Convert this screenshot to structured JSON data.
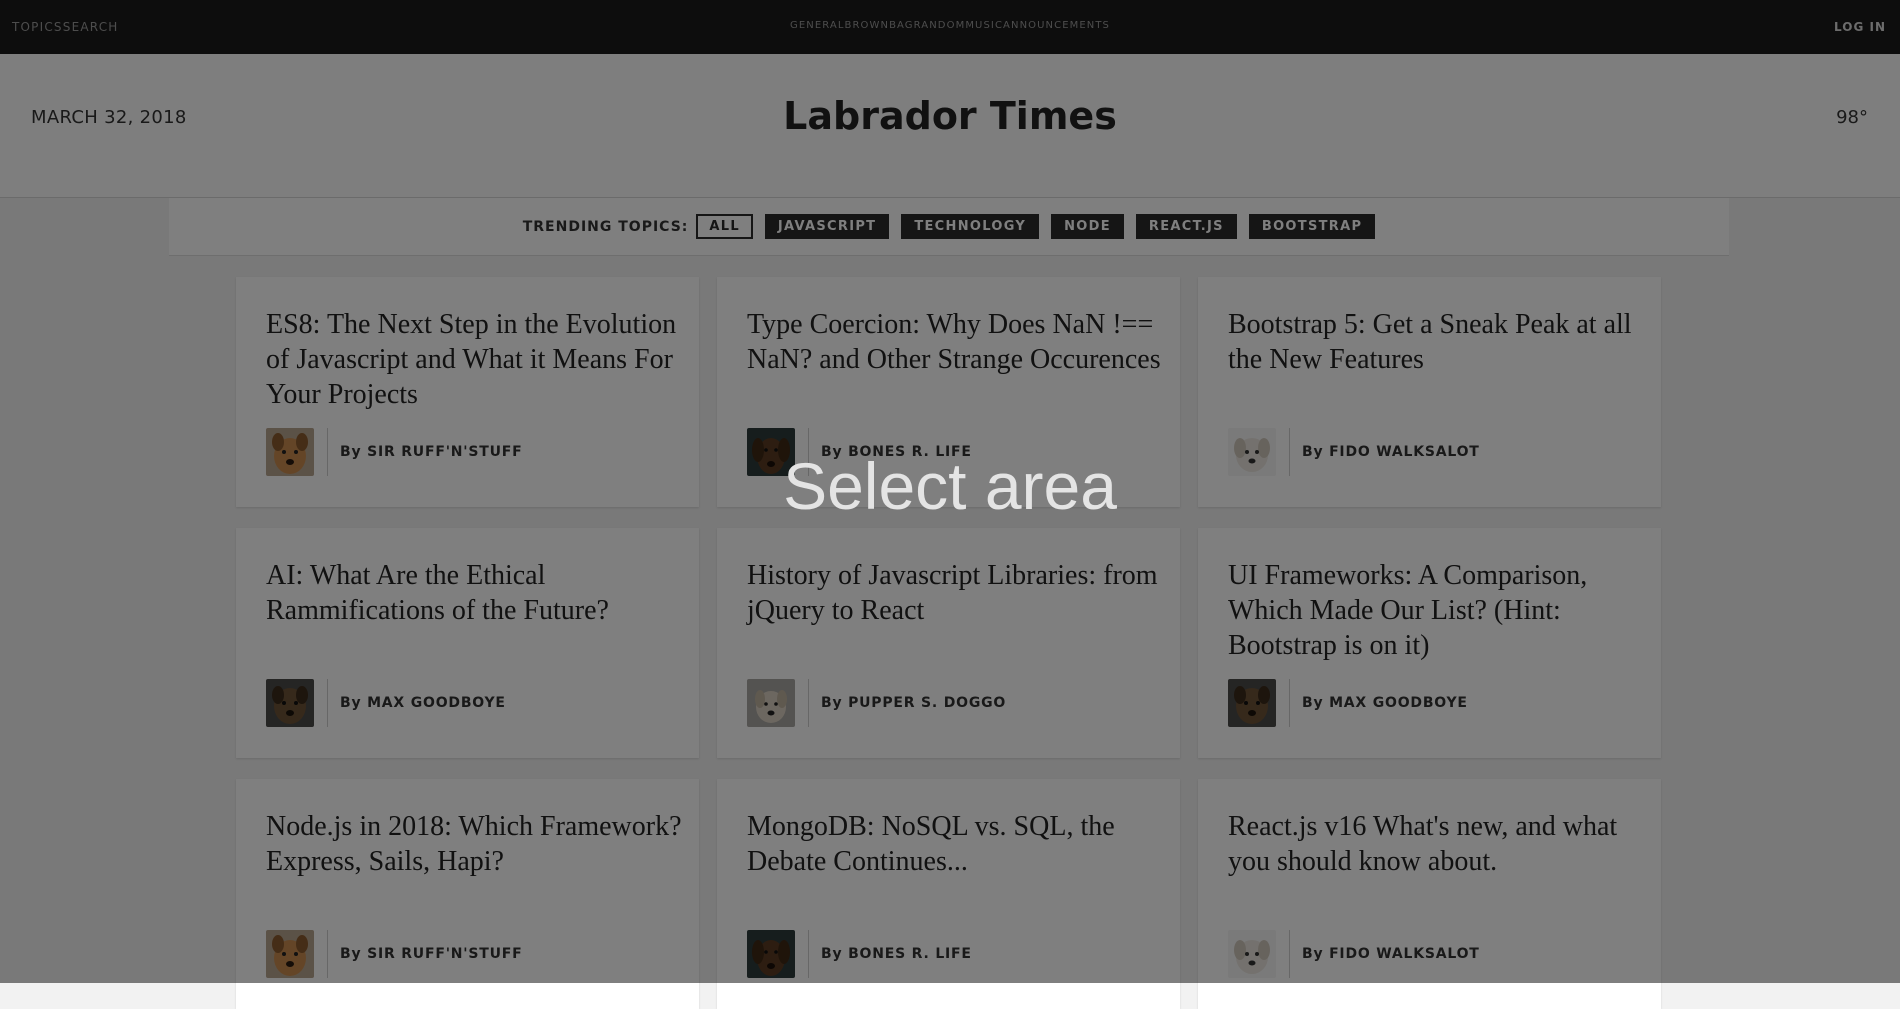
{
  "nav": {
    "brand": [
      "TOPICS",
      "SEARCH"
    ],
    "links": [
      "GENERAL",
      "BROWNBAG",
      "RANDOM",
      "MUSIC",
      "ANNOUNCEMENTS"
    ],
    "login": "LOG IN"
  },
  "masthead": {
    "date": "MARCH 32, 2018",
    "title": "Labrador Times",
    "temperature": "98°"
  },
  "trending": {
    "label": "TRENDING TOPICS:",
    "topics": [
      "ALL",
      "JAVASCRIPT",
      "TECHNOLOGY",
      "NODE",
      "REACT.JS",
      "BOOTSTRAP"
    ],
    "active": "ALL"
  },
  "articles": [
    {
      "title": "ES8: The Next Step in the Evolution of Javascript and What it Means For Your Projects",
      "author": "By SIR RUFF'N'STUFF",
      "avatar": "dog-tan"
    },
    {
      "title": "Type Coercion: Why Does NaN !== NaN? and Other Strange Occurences",
      "author": "By BONES R. LIFE",
      "avatar": "dog-brown"
    },
    {
      "title": "Bootstrap 5: Get a Sneak Peak at all the New Features",
      "author": "By FIDO WALKSALOT",
      "avatar": "dog-white"
    },
    {
      "title": "AI: What Are the Ethical Rammifications of the Future?",
      "author": "By MAX GOODBOYE",
      "avatar": "dog-brindle"
    },
    {
      "title": "History of Javascript Libraries: from jQuery to React",
      "author": "By PUPPER S. DOGGO",
      "avatar": "dog-cream"
    },
    {
      "title": "UI Frameworks: A Comparison, Which Made Our List? (Hint: Bootstrap is on it)",
      "author": "By MAX GOODBOYE",
      "avatar": "dog-brindle"
    },
    {
      "title": "Node.js in 2018: Which Framework? Express, Sails, Hapi?",
      "author": "By SIR RUFF'N'STUFF",
      "avatar": "dog-tan"
    },
    {
      "title": "MongoDB: NoSQL vs. SQL, the Debate Continues...",
      "author": "By BONES R. LIFE",
      "avatar": "dog-brown"
    },
    {
      "title": "React.js v16 What's new, and what you should know about.",
      "author": "By FIDO WALKSALOT",
      "avatar": "dog-white"
    }
  ],
  "overlay": {
    "text": "Select area"
  },
  "colors": {
    "nav_bg": "#1b1b1b",
    "chip_bg": "#2a2a2a",
    "overlay": "rgba(0,0,0,0.5)",
    "avatar_colors": {
      "dog-tan": "#c98b4f",
      "dog-brown": "#5a3b22",
      "dog-white": "#e8e3dc",
      "dog-brindle": "#6d5237",
      "dog-cream": "#d9cfc0"
    }
  }
}
